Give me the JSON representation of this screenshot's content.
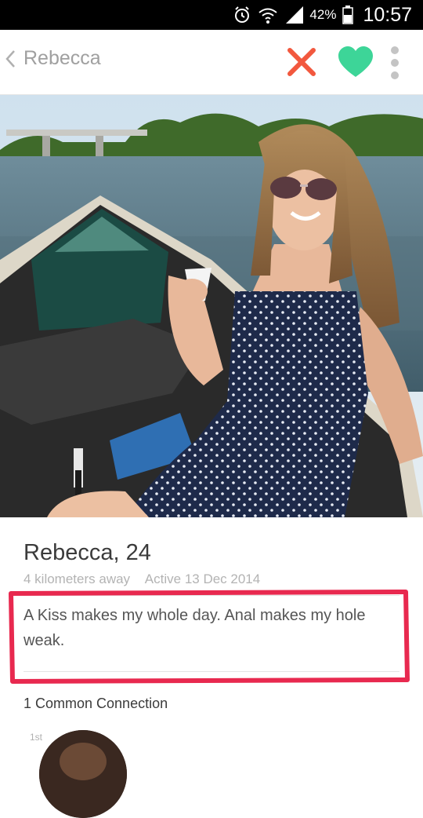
{
  "status_bar": {
    "battery_percent": "42%",
    "time": "10:57",
    "icons": [
      "alarm-icon",
      "wifi-icon",
      "signal-icon",
      "battery-icon"
    ]
  },
  "header": {
    "back_label": "Rebecca",
    "icons": [
      "chevron-left-icon",
      "close-icon",
      "heart-icon",
      "more-vertical-icon"
    ],
    "colors": {
      "nope": "#f2583e",
      "like": "#3dd598"
    }
  },
  "profile": {
    "name_age": "Rebecca, 24",
    "distance": "4 kilometers away",
    "active": "Active 13 Dec 2014",
    "bio": "A Kiss makes my whole day. Anal makes my hole weak."
  },
  "connections": {
    "title": "1 Common Connection",
    "badge": "1st"
  },
  "annotation": {
    "color": "#e8294f"
  }
}
